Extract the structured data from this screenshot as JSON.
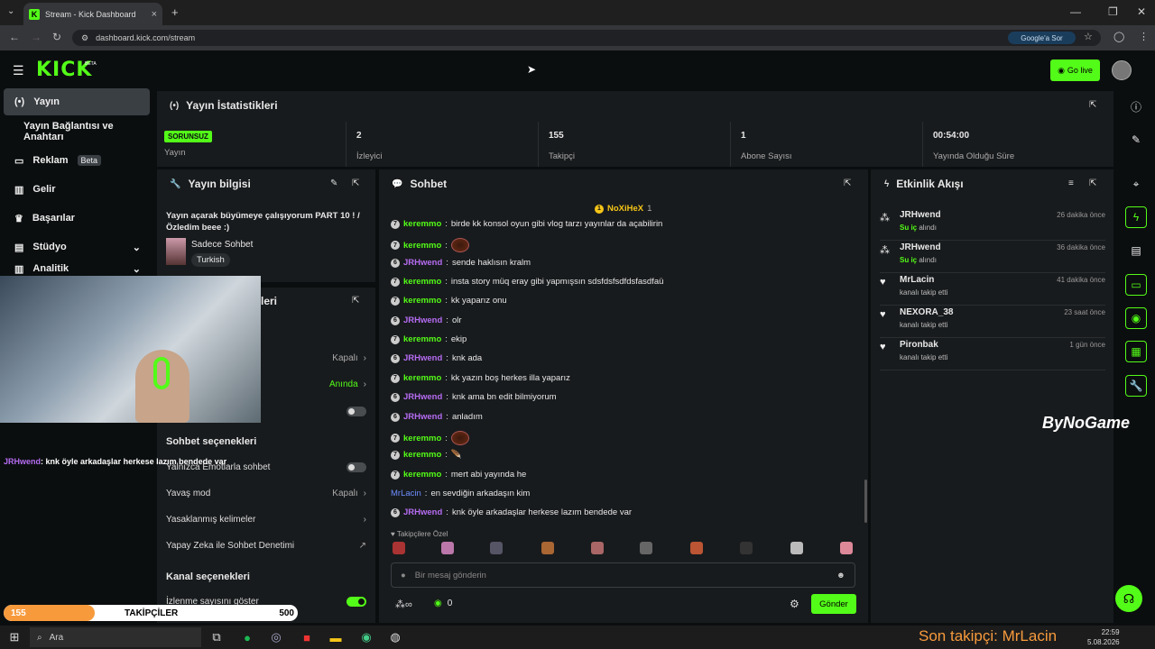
{
  "browser": {
    "tab_title": "Stream - Kick Dashboard",
    "url": "dashboard.kick.com/stream",
    "google_btn": "Google'a Sor"
  },
  "header": {
    "logo": "KICK",
    "beta": "BETA",
    "golive": "Go live"
  },
  "sidebar": {
    "items": [
      {
        "label": "Yayın",
        "icon": "broadcast-icon"
      },
      {
        "label": "Yayın Bağlantısı ve Anahtarı"
      },
      {
        "label": "Reklam",
        "badge": "Beta"
      },
      {
        "label": "Gelir"
      },
      {
        "label": "Başarılar"
      },
      {
        "label": "Stüdyo"
      },
      {
        "label": "Analitik"
      }
    ]
  },
  "stats": {
    "title": "Yayın İstatistikleri",
    "status": "SORUNSUZ",
    "items": [
      {
        "value": "",
        "label": "Yayın"
      },
      {
        "value": "2",
        "label": "İzleyici"
      },
      {
        "value": "155",
        "label": "Takipçi"
      },
      {
        "value": "1",
        "label": "Abone Sayısı"
      },
      {
        "value": "00:54:00",
        "label": "Yayında Olduğu Süre"
      }
    ]
  },
  "info": {
    "title": "Yayın bilgisi",
    "stream_title": "Yayın açarak büyümeye çalışıyorum PART 10 ! / Özledim beee :)",
    "category": "Sadece Sohbet",
    "language": "Turkish"
  },
  "settings": {
    "title_fragment": "leri",
    "rows": [
      {
        "label": "",
        "value": "Kapalı"
      },
      {
        "label": "",
        "value": "Anında"
      }
    ],
    "chat_section": "Sohbet seçenekleri",
    "chat_rows": [
      "Yalnızca Emotlarla sohbet",
      "Yavaş mod",
      "Yasaklanmış kelimeler",
      "Yapay Zeka ile Sohbet Denetimi"
    ],
    "slow_value": "Kapalı",
    "channel_section": "Kanal seçenekleri",
    "channel_row": "İzlenme sayısını göster"
  },
  "chat": {
    "title": "Sohbet",
    "pinned_user": "NoXiHeX",
    "pinned_count": "1",
    "messages": [
      {
        "badge": "7",
        "user": "keremmo",
        "cls": "u1",
        "text": "birde kk konsol oyun gibi vlog tarzı yayınlar da açabilirin"
      },
      {
        "badge": "7",
        "user": "keremmo",
        "cls": "u1",
        "text": "",
        "emote": true
      },
      {
        "badge": "6",
        "user": "JRHwend",
        "cls": "u2",
        "text": "sende haklısın kralm"
      },
      {
        "badge": "7",
        "user": "keremmo",
        "cls": "u1",
        "text": "insta story müq eray gibi yapmışsın sdsfdsfsdfdsfasdfaü"
      },
      {
        "badge": "7",
        "user": "keremmo",
        "cls": "u1",
        "text": "kk yaparız onu"
      },
      {
        "badge": "6",
        "user": "JRHwend",
        "cls": "u2",
        "text": "olr"
      },
      {
        "badge": "7",
        "user": "keremmo",
        "cls": "u1",
        "text": "ekip"
      },
      {
        "badge": "6",
        "user": "JRHwend",
        "cls": "u2",
        "text": "knk ada"
      },
      {
        "badge": "7",
        "user": "keremmo",
        "cls": "u1",
        "text": "kk yazın boş herkes illa yaparız"
      },
      {
        "badge": "6",
        "user": "JRHwend",
        "cls": "u2",
        "text": "knk ama bn edit bilmiyorum"
      },
      {
        "badge": "6",
        "user": "JRHwend",
        "cls": "u2",
        "text": "anladım"
      },
      {
        "badge": "7",
        "user": "keremmo",
        "cls": "u1",
        "text": "",
        "emote": true
      },
      {
        "badge": "7",
        "user": "keremmo",
        "cls": "u1",
        "text": "🪶"
      },
      {
        "badge": "7",
        "user": "keremmo",
        "cls": "u1",
        "text": "mert abi yayında he"
      },
      {
        "badge": "",
        "user": "MrLacin",
        "cls": "u3",
        "text": "en sevdiğin arkadaşın kim"
      },
      {
        "badge": "6",
        "user": "JRHwend",
        "cls": "u2",
        "text": "knk öyle arkadaşlar herkese lazım bendede var"
      }
    ],
    "followers_only": "Takipçilere Özel",
    "placeholder": "Bir mesaj gönderin",
    "count": "0",
    "send": "Gönder"
  },
  "events": {
    "title": "Etkinlik Akışı",
    "items": [
      {
        "name": "JRHwend",
        "sub": "Su iç alındı",
        "time": "26 dakika önce",
        "hl": "Su iç"
      },
      {
        "name": "JRHwend",
        "sub": "Su iç alındı",
        "time": "36 dakika önce",
        "hl": "Su iç"
      },
      {
        "name": "MrLacin",
        "sub": "kanalı takip etti",
        "time": "41 dakika önce"
      },
      {
        "name": "NEXORA_38",
        "sub": "kanalı takip etti",
        "time": "23 saat önce"
      },
      {
        "name": "Pironbak",
        "sub": "kanalı takip etti",
        "time": "1 gün önce"
      }
    ]
  },
  "overlay": {
    "chat_user": "JRHwend",
    "chat_text": ": knk öyle arkadaşlar herkese lazım bendede var",
    "follow_current": "155",
    "follow_label": "TAKİPÇİLER",
    "follow_goal": "500",
    "follow_progress": 0.31,
    "brand": "ByNoGame",
    "last_follower": "Son takipçi: MrLacin"
  },
  "taskbar": {
    "search": "Ara",
    "time": "22:59",
    "date": "5.08.2026"
  }
}
